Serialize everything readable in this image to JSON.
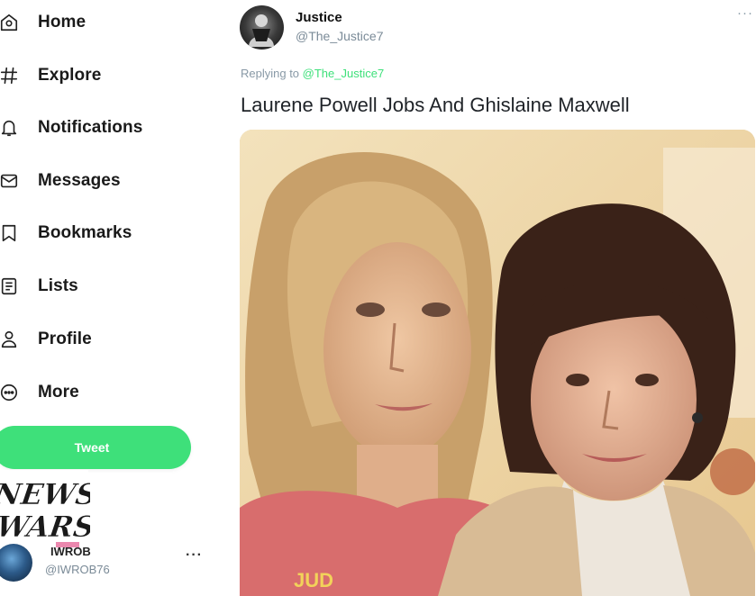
{
  "sidebar": {
    "items": [
      {
        "label": "Home",
        "icon": "home-icon"
      },
      {
        "label": "Explore",
        "icon": "hashtag-icon"
      },
      {
        "label": "Notifications",
        "icon": "bell-icon"
      },
      {
        "label": "Messages",
        "icon": "envelope-icon"
      },
      {
        "label": "Bookmarks",
        "icon": "bookmark-icon"
      },
      {
        "label": "Lists",
        "icon": "list-icon"
      },
      {
        "label": "Profile",
        "icon": "person-icon"
      },
      {
        "label": "More",
        "icon": "more-circle-icon"
      }
    ],
    "tweet_button": "Tweet",
    "logo_text": [
      "NEWS",
      "WARS"
    ],
    "account": {
      "name": "IWROB",
      "handle": "@IWROB76",
      "more": "···"
    }
  },
  "tweet": {
    "author_name": "Justice",
    "author_handle": "@The_Justice7",
    "more": "···",
    "replying_prefix": "Replying to ",
    "replying_to": "@The_Justice7",
    "text": "Laurene Powell Jobs And Ghislaine Maxwell",
    "photo_alt": "photo",
    "shirt_fragment": "JUD"
  },
  "colors": {
    "accent": "#3ee07a",
    "muted_text": "#8899a6"
  }
}
